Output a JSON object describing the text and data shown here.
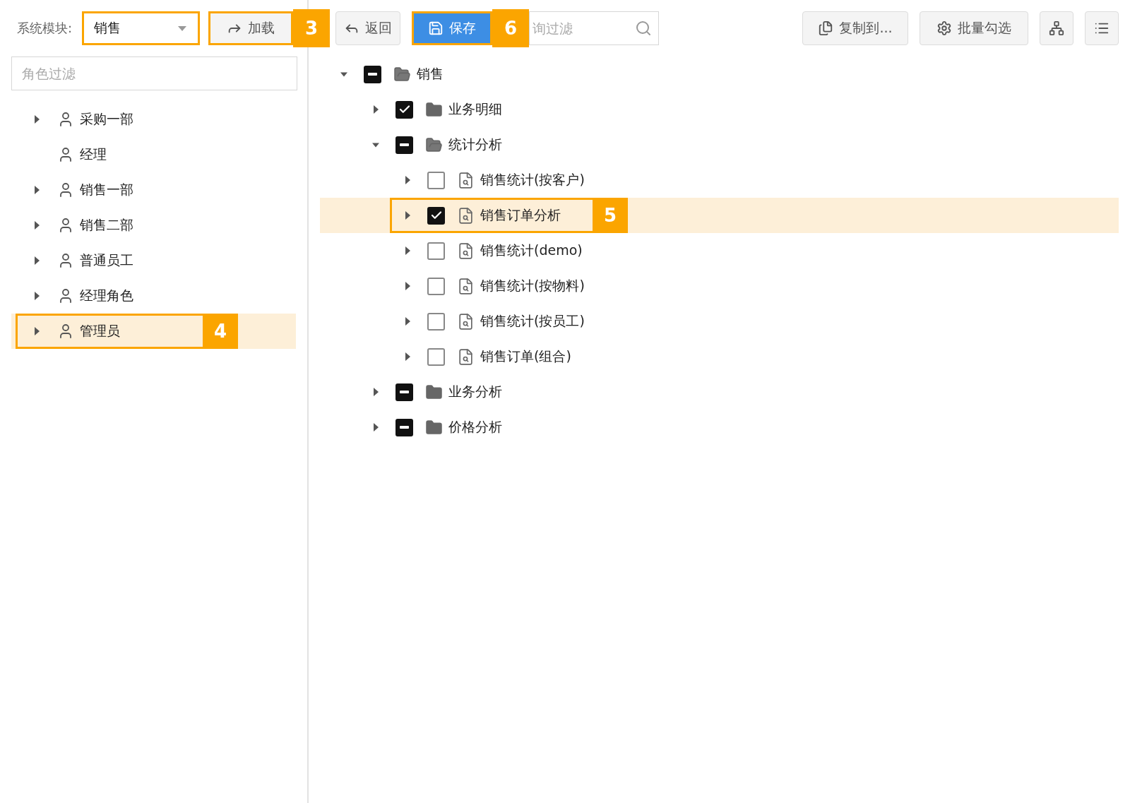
{
  "module_label": "系统模块:",
  "module_select": {
    "value": "销售",
    "highlighted": true
  },
  "load_button": {
    "label": "加载",
    "callout": "3"
  },
  "back_button": {
    "label": "返回"
  },
  "save_button": {
    "label": "保存",
    "callout": "6"
  },
  "filter_field": {
    "placeholder": "询过滤"
  },
  "copy_button": {
    "label": "复制到..."
  },
  "batch_button": {
    "label": "批量勾选"
  },
  "role_filter": {
    "placeholder": "角色过滤"
  },
  "roles": [
    {
      "label": "采购一部",
      "expandable": true,
      "selected": false
    },
    {
      "label": "经理",
      "expandable": false,
      "selected": false
    },
    {
      "label": "销售一部",
      "expandable": true,
      "selected": false
    },
    {
      "label": "销售二部",
      "expandable": true,
      "selected": false
    },
    {
      "label": "普通员工",
      "expandable": true,
      "selected": false
    },
    {
      "label": "经理角色",
      "expandable": true,
      "selected": false
    },
    {
      "label": "管理员",
      "expandable": true,
      "selected": true,
      "callout": "4"
    }
  ],
  "menu_tree": [
    {
      "label": "销售",
      "kind": "folder",
      "expanded": true,
      "checked": false,
      "partial": true,
      "selected": false,
      "children": [
        {
          "label": "业务明细",
          "kind": "folder",
          "expanded": false,
          "checked": true,
          "partial": false,
          "selected": false
        },
        {
          "label": "统计分析",
          "kind": "folder",
          "expanded": true,
          "checked": false,
          "partial": true,
          "selected": false,
          "children": [
            {
              "label": "销售统计(按客户)",
              "kind": "report",
              "expanded": false,
              "checked": false,
              "partial": false,
              "selected": false
            },
            {
              "label": "销售订单分析",
              "kind": "report",
              "expanded": false,
              "checked": true,
              "partial": false,
              "selected": true,
              "callout": "5"
            },
            {
              "label": "销售统计(demo)",
              "kind": "report",
              "expanded": false,
              "checked": false,
              "partial": false,
              "selected": false
            },
            {
              "label": "销售统计(按物料)",
              "kind": "report",
              "expanded": false,
              "checked": false,
              "partial": false,
              "selected": false
            },
            {
              "label": "销售统计(按员工)",
              "kind": "report",
              "expanded": false,
              "checked": false,
              "partial": false,
              "selected": false
            },
            {
              "label": "销售订单(组合)",
              "kind": "report",
              "expanded": false,
              "checked": false,
              "partial": false,
              "selected": false
            }
          ]
        },
        {
          "label": "业务分析",
          "kind": "folder",
          "expanded": false,
          "checked": false,
          "partial": true,
          "selected": false
        },
        {
          "label": "价格分析",
          "kind": "folder",
          "expanded": false,
          "checked": false,
          "partial": true,
          "selected": false
        }
      ]
    }
  ]
}
